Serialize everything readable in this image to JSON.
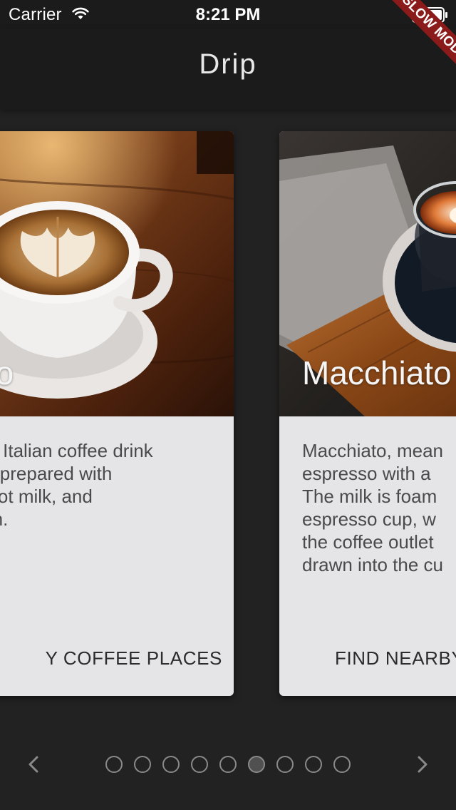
{
  "status_bar": {
    "carrier": "Carrier",
    "time": "8:21 PM"
  },
  "debug_banner": "SLOW MODE",
  "app_bar": {
    "title": "Drip"
  },
  "cards": [
    {
      "name": "no",
      "description_lines": [
        "an Italian coffee drink",
        "lly prepared with",
        ", hot milk, and",
        "am."
      ],
      "action": "Y COFFEE PLACES",
      "image": "cappuccino-latte-art-photo"
    },
    {
      "name": "Macchiato",
      "description_lines": [
        "Macchiato, mean",
        "espresso with a",
        "The milk is foam",
        "espresso cup, w",
        "the coffee outlet",
        "drawn into the cu"
      ],
      "action": "FIND NEARBY",
      "image": "macchiato-glass-photo"
    }
  ],
  "pager": {
    "prev_icon": "chevron-left-icon",
    "next_icon": "chevron-right-icon",
    "dot_count": 9,
    "active_index": 5
  },
  "colors": {
    "background": "#222222",
    "app_bar": "#1b1b1b",
    "card": "#e5e5e7",
    "banner": "#8b1a1a",
    "dot_border": "#8a8a8a",
    "dot_active": "#505050"
  }
}
